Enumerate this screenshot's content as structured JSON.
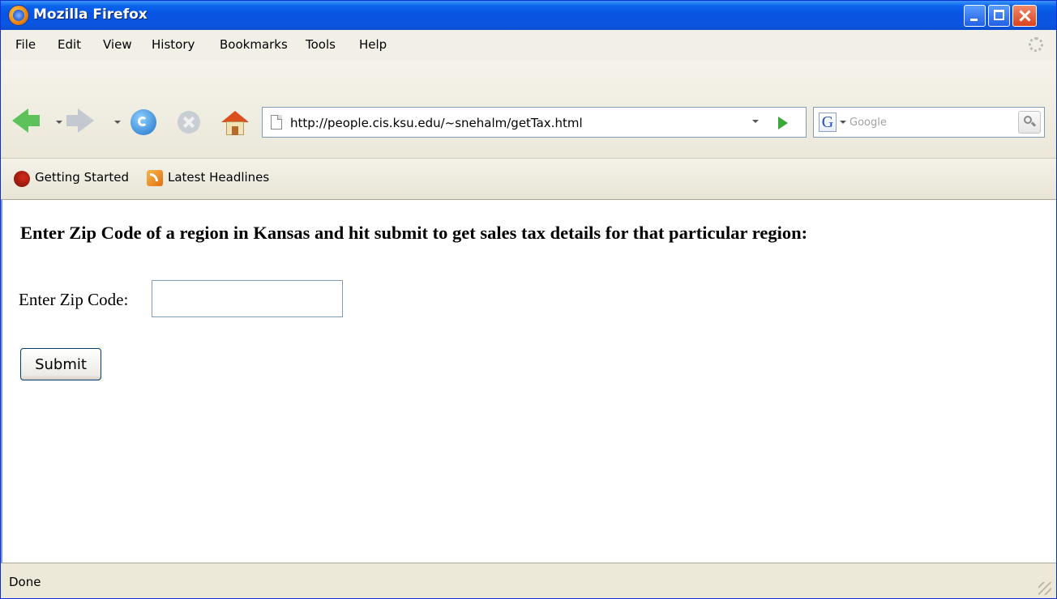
{
  "window": {
    "title": "Mozilla Firefox"
  },
  "menu": {
    "items": [
      "File",
      "Edit",
      "View",
      "History",
      "Bookmarks",
      "Tools",
      "Help"
    ]
  },
  "navigation": {
    "url": "http://people.cis.ksu.edu/~snehalm/getTax.html",
    "search_engine_icon": "G",
    "search_placeholder": "Google"
  },
  "bookmarks": {
    "items": [
      "Getting Started",
      "Latest Headlines"
    ]
  },
  "page": {
    "heading": "Enter Zip Code of a region in Kansas and hit submit to get sales tax details for that particular region:",
    "zip_label": "Enter Zip Code:",
    "zip_value": "",
    "submit_label": "Submit"
  },
  "status": {
    "text": "Done"
  },
  "colors": {
    "titlebar": "#0a56e2",
    "chrome": "#ece9d8",
    "content_bg": "#ffffff"
  }
}
